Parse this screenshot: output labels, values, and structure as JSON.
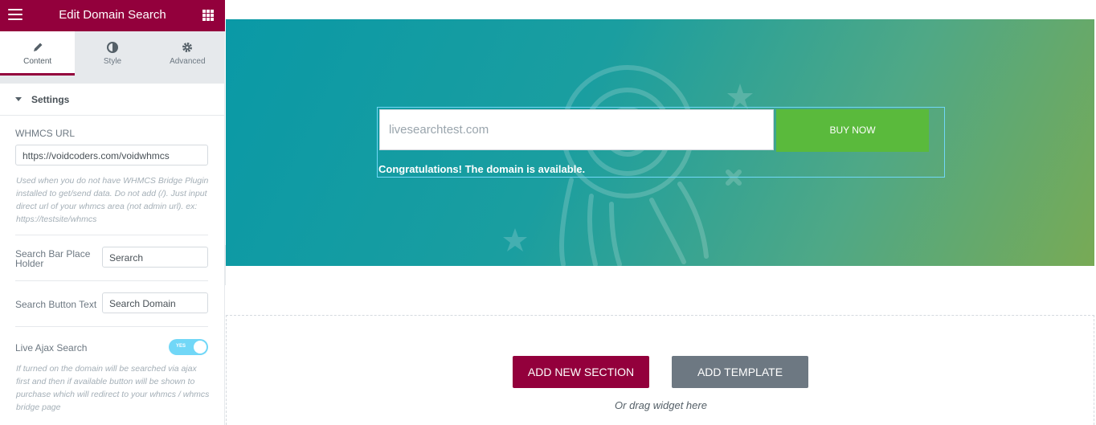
{
  "panel": {
    "title": "Edit Domain Search",
    "tabs": [
      {
        "label": "Content",
        "icon": "pencil-icon"
      },
      {
        "label": "Style",
        "icon": "half-circle-icon"
      },
      {
        "label": "Advanced",
        "icon": "gear-icon"
      }
    ],
    "section_title": "Settings",
    "whmcs_url": {
      "label": "WHMCS URL",
      "value": "https://voidcoders.com/voidwhmcs",
      "description": "Used when you do not have WHMCS Bridge Plugin installed to get/send data. Do not add (/). Just input direct url of your whmcs area (not admin url). ex: https://testsite/whmcs"
    },
    "search_placeholder": {
      "label": "Search Bar Place Holder",
      "value": "Serarch"
    },
    "search_button_text": {
      "label": "Search Button Text",
      "value": "Search Domain"
    },
    "live_ajax": {
      "label": "Live Ajax Search",
      "toggle_text": "YES",
      "enabled": true,
      "description": "If turned on the domain will be searched via ajax first and then if available button will be shown to purchase which will redirect to your whmcs / whmcs bridge page"
    }
  },
  "preview": {
    "domain_value": "livesearchtest.com",
    "buy_button": "BUY NOW",
    "availability_message": "Congratulations! The domain is available.",
    "add_section_button": "ADD NEW SECTION",
    "add_template_button": "ADD TEMPLATE",
    "drag_hint": "Or drag widget here"
  },
  "colors": {
    "brand": "#93003c",
    "buy_button": "#5aba3c",
    "toggle_on": "#71d7f7",
    "template_button": "#6d7882"
  }
}
